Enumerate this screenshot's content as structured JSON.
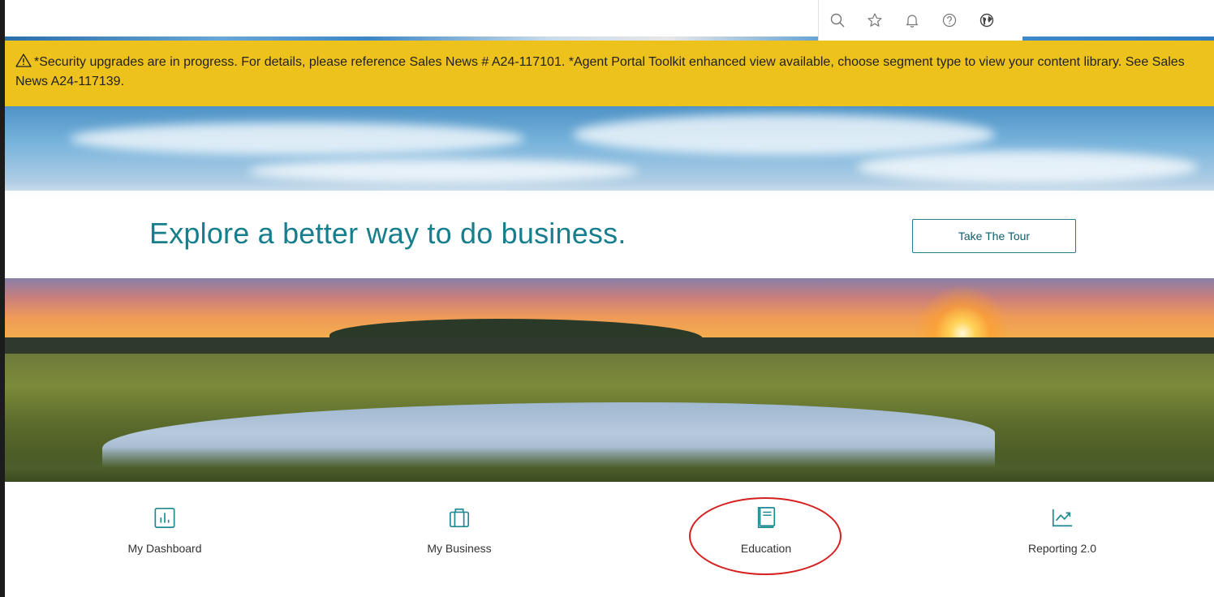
{
  "topbar": {
    "icons": [
      "search-icon",
      "star-icon",
      "bell-icon",
      "help-icon",
      "globe-icon"
    ]
  },
  "banner": {
    "icon": "warning-icon",
    "text": "*Security upgrades are in progress. For details, please reference Sales News # A24-117101. *Agent Portal Toolkit enhanced view available, choose segment type to view your content library. See Sales News A24-117139.",
    "color": "#eec21d"
  },
  "hero": {
    "title": "Explore a better way to do business.",
    "button_label": "Take The Tour",
    "accent": "#167e8c"
  },
  "tiles": [
    {
      "label": "My Dashboard",
      "icon": "bar-chart-icon"
    },
    {
      "label": "My Business",
      "icon": "briefcase-icon"
    },
    {
      "label": "Education",
      "icon": "book-icon"
    },
    {
      "label": "Reporting 2.0",
      "icon": "trending-chart-icon"
    }
  ],
  "annotation": {
    "color": "#d61f1f"
  }
}
